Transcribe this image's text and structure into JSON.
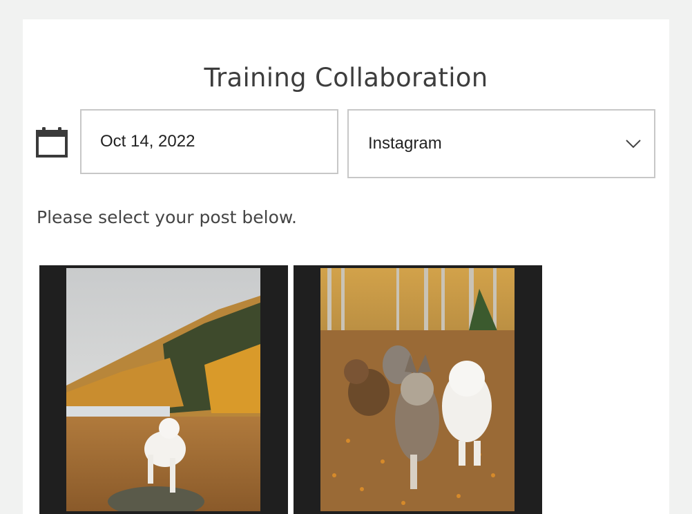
{
  "page": {
    "title": "Training Collaboration"
  },
  "filters": {
    "date_value": "Oct 14, 2022",
    "platform_value": "Instagram"
  },
  "instructions": "Please select your post below.",
  "icons": {
    "calendar": "calendar-icon",
    "dropdown": "chevron-down-icon"
  },
  "posts": [
    {
      "id": "post-1",
      "image": "white dog on rock with autumn mountain"
    },
    {
      "id": "post-2",
      "image": "four dogs on leaf-covered trail"
    }
  ],
  "colors": {
    "background": "#f1f2f1",
    "card": "#ffffff",
    "border": "#c7c7c7",
    "post_frame": "#1f1f1f"
  }
}
